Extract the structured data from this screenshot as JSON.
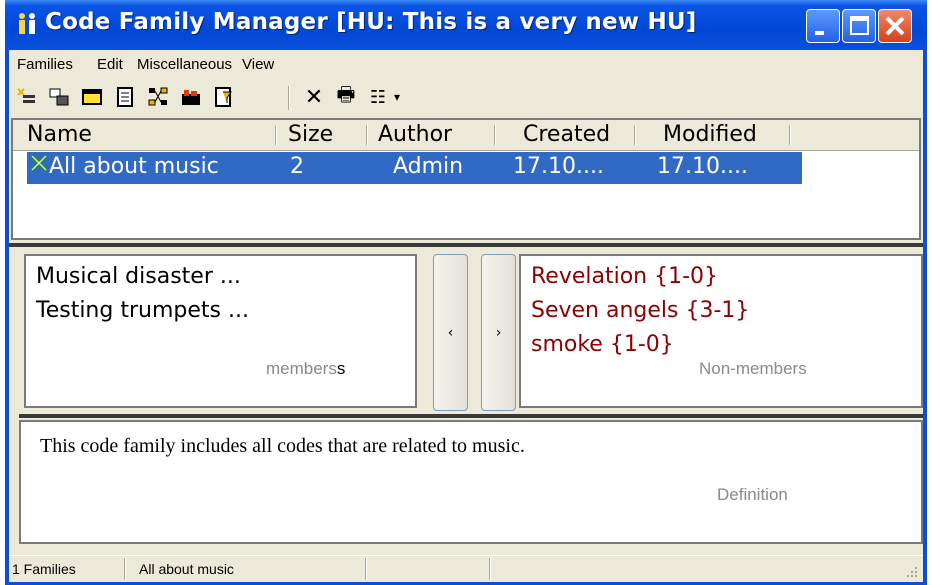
{
  "window": {
    "title": "Code Family Manager [HU: This is a very new HU]"
  },
  "titlebar_buttons": [
    "minimize",
    "maximize",
    "close"
  ],
  "menubar": [
    "Families",
    "Edit",
    "Miscellaneous",
    "View"
  ],
  "toolbar": {
    "tools": [
      {
        "name": "new-family-icon"
      },
      {
        "name": "duplicate-icon"
      },
      {
        "name": "window-icon"
      },
      {
        "name": "document-icon"
      },
      {
        "name": "network-icon"
      },
      {
        "name": "codes-icon"
      },
      {
        "name": "filter-icon"
      }
    ],
    "tools2": [
      {
        "name": "delete-icon",
        "glyph": "✕"
      },
      {
        "name": "print-icon",
        "glyph": "🖶"
      },
      {
        "name": "view-options-icon",
        "glyph": "☷"
      },
      {
        "name": "dropdown-arrow-icon",
        "glyph": "▾"
      }
    ]
  },
  "families_list": {
    "columns": [
      "Name",
      "Size",
      "Author",
      "Created",
      "Modified"
    ],
    "rows": [
      {
        "name": "All about music",
        "size": "2",
        "author": "Admin",
        "created": "17.10....",
        "modified": "17.10...."
      }
    ]
  },
  "members": {
    "items": [
      "Musical disaster ...",
      "Testing trumpets ..."
    ],
    "caption_main": "members",
    "caption_tail": "s"
  },
  "nonmembers": {
    "items": [
      "Revelation {1-0}",
      "Seven angels {3-1}",
      "smoke {1-0}"
    ],
    "caption": "Non-members"
  },
  "buttons": {
    "add_to_members": "‹",
    "remove_from_members": "›"
  },
  "definition": {
    "text": "This code family includes all codes that are related to music.",
    "caption": "Definition"
  },
  "statusbar": {
    "count": "1 Families",
    "selected": "All about music"
  },
  "colors": {
    "titlebar": "#0a4fd6",
    "selection": "#316ac5",
    "nonmember_text": "#8b0000",
    "window_bg": "#ece9d8"
  }
}
